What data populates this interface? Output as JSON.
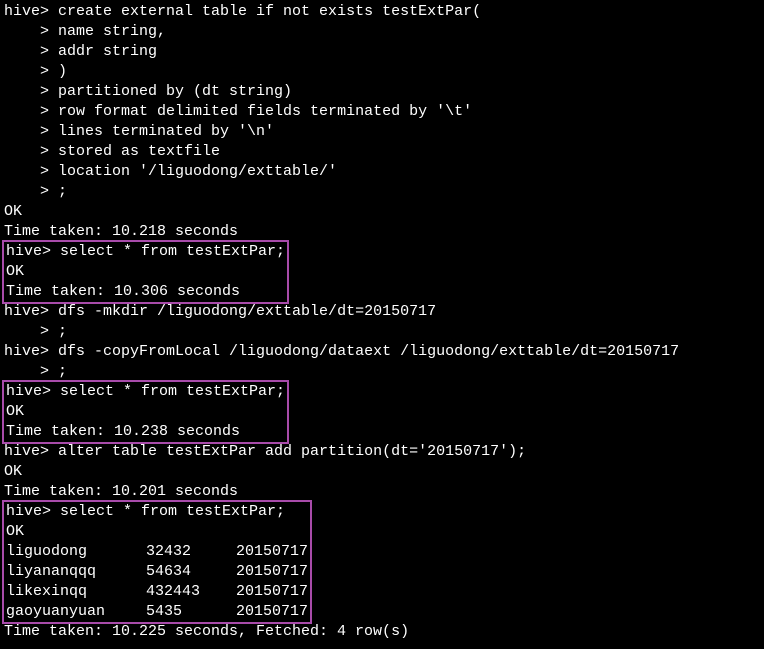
{
  "prompt_main": "hive>",
  "prompt_cont": "    >",
  "block1": {
    "l1": " create external table if not exists testExtPar(",
    "l2": " name string,",
    "l3": " addr string",
    "l4": " )",
    "l5": " partitioned by (dt string)",
    "l6": " row format delimited fields terminated by '\\t'",
    "l7": " lines terminated by '\\n'",
    "l8": " stored as textfile",
    "l9": " location '/liguodong/exttable/'",
    "l10": " ;"
  },
  "ok": "OK",
  "time1": "Time taken: 10.218 seconds",
  "sel1": {
    "cmd": " select * from testExtPar;",
    "time": "Time taken: 10.306 seconds"
  },
  "mkdir": {
    "cmd": " dfs -mkdir /liguodong/exttable/dt=20150717",
    "cont": " ;"
  },
  "copy": {
    "cmd": " dfs -copyFromLocal /liguodong/dataext /liguodong/exttable/dt=20150717",
    "cont": " ;"
  },
  "sel2": {
    "cmd": " select * from testExtPar;",
    "time": "Time taken: 10.238 seconds"
  },
  "alter": {
    "cmd": " alter table testExtPar add partition(dt='20150717');",
    "time": "Time taken: 10.201 seconds"
  },
  "sel3": {
    "cmd": " select * from testExtPar;"
  },
  "rows": [
    {
      "c1": "liguodong",
      "c2": "32432",
      "c3": "20150717"
    },
    {
      "c1": "liyananqqq",
      "c2": "54634",
      "c3": "20150717"
    },
    {
      "c1": "likexinqq",
      "c2": "432443",
      "c3": "20150717"
    },
    {
      "c1": "gaoyuanyuan",
      "c2": "5435",
      "c3": "20150717"
    }
  ],
  "time_final": "Time taken: 10.225 seconds, Fetched: 4 row(s)"
}
